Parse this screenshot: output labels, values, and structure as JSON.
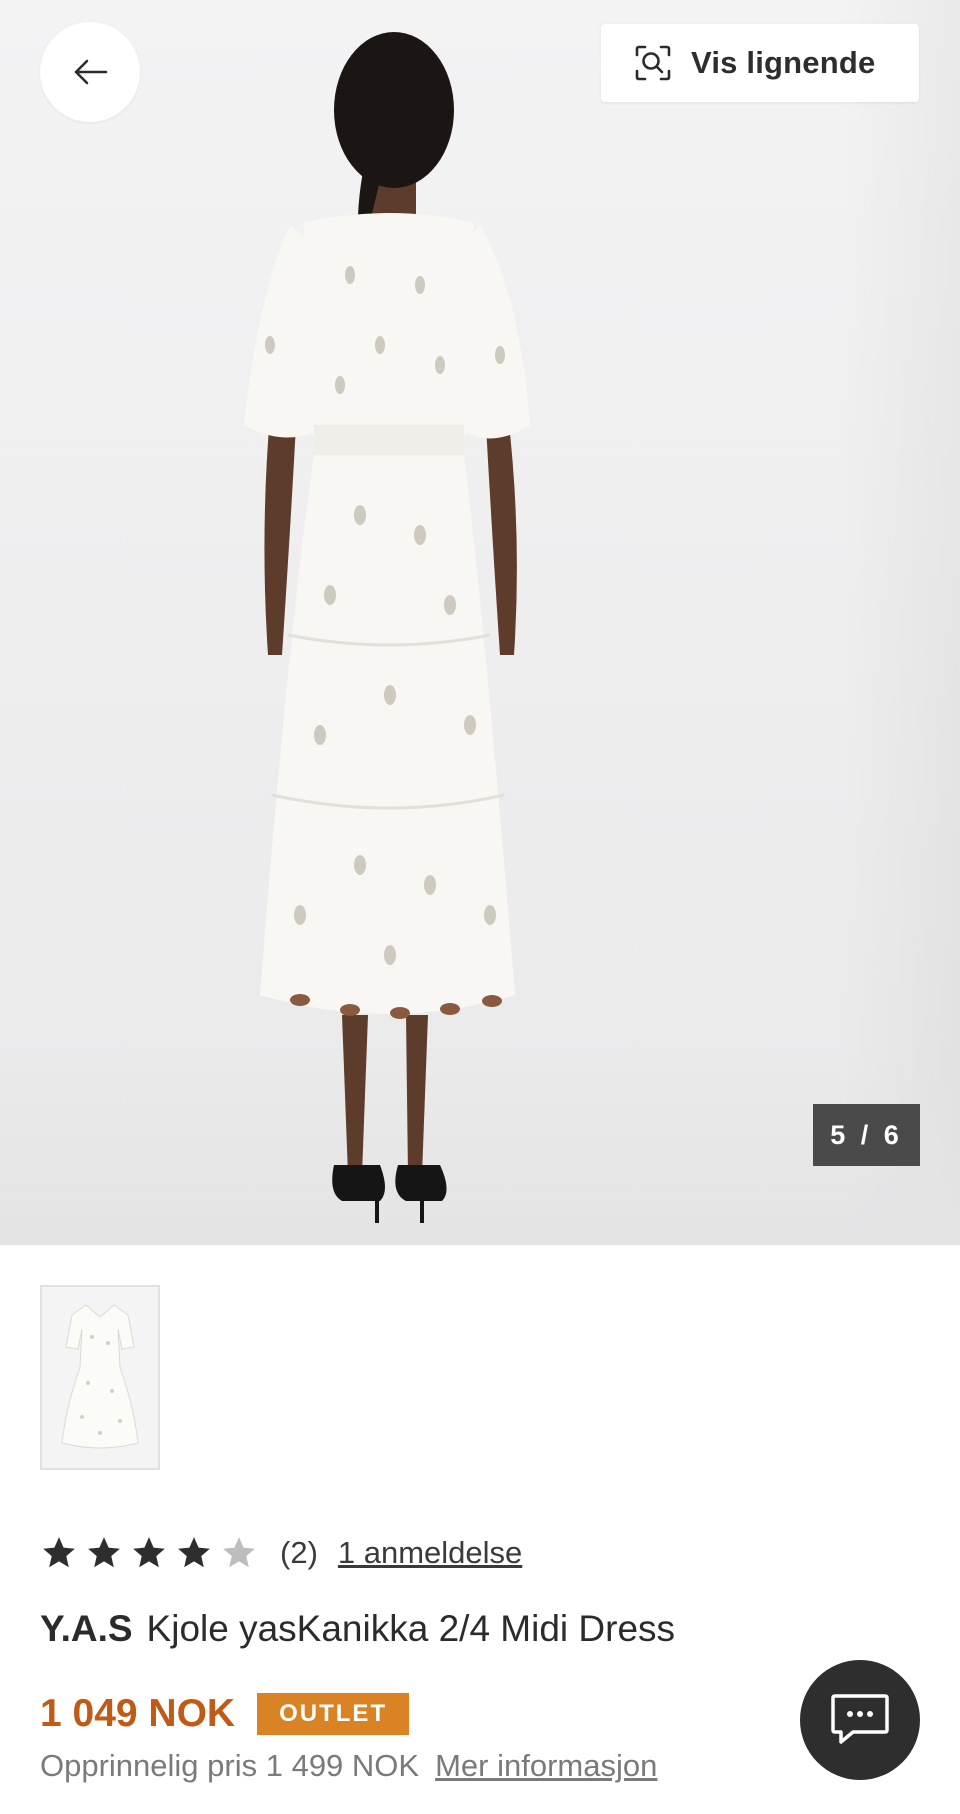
{
  "gallery": {
    "back_icon": "arrow-left-icon",
    "similar_button": {
      "icon": "visual-search-icon",
      "label": "Vis lignende"
    },
    "counter": "5 / 6"
  },
  "product": {
    "rating": {
      "value": 4,
      "max": 5,
      "count_label": "(2)",
      "reviews_link": "1 anmeldelse"
    },
    "brand": "Y.A.S",
    "name": "Kjole yasKanikka 2/4 Midi Dress",
    "price": "1 049 NOK",
    "badge": "OUTLET",
    "original_price": "Opprinnelig pris 1 499 NOK",
    "more_info_link": "Mer informasjon"
  },
  "chat": {
    "icon": "chat-bubble-icon"
  },
  "colors": {
    "price": "#c05a17",
    "badge_bg": "#d98324",
    "star_filled": "#2e2e2e",
    "star_empty": "#bdbdbd",
    "counter_bg": "#4a4a4a",
    "chat_bg": "#2e2e2e"
  }
}
